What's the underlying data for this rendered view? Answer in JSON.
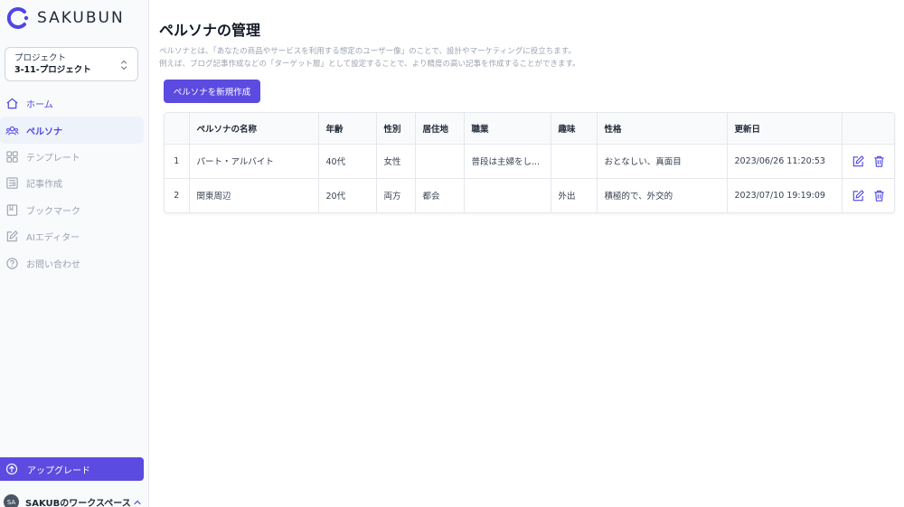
{
  "brand": {
    "name": "SAKUBUN"
  },
  "project": {
    "label": "プロジェクト",
    "name": "3-11-プロジェクト"
  },
  "nav": {
    "items": [
      {
        "label": "ホーム",
        "icon": "home-icon"
      },
      {
        "label": "ペルソナ",
        "icon": "persona-icon"
      },
      {
        "label": "テンプレート",
        "icon": "template-icon"
      },
      {
        "label": "記事作成",
        "icon": "article-icon"
      },
      {
        "label": "ブックマーク",
        "icon": "bookmark-icon"
      },
      {
        "label": "AIエディター",
        "icon": "editor-icon"
      },
      {
        "label": "お問い合わせ",
        "icon": "help-icon"
      }
    ]
  },
  "upgrade": {
    "label": "アップグレード"
  },
  "workspace": {
    "initials": "SA",
    "name": "SAKUBのワークスペース"
  },
  "page": {
    "title": "ペルソナの管理",
    "desc1": "ペルソナとは、「あなたの商品やサービスを利用する想定のユーザー像」のことで、設計やマーケティングに役立ちます。",
    "desc2": "例えば、ブログ記事作成などの「ターゲット層」として設定することで、より精度の高い記事を作成することができます。",
    "new_button": "ペルソナを新規作成"
  },
  "table": {
    "headers": [
      "",
      "ペルソナの名称",
      "年齢",
      "性別",
      "居住地",
      "職業",
      "趣味",
      "性格",
      "更新日",
      ""
    ],
    "rows": [
      {
        "no": "1",
        "name": "パート・アルバイト",
        "age": "40代",
        "gender": "女性",
        "residence": "",
        "job": "普段は主婦をし...",
        "hobby": "",
        "personality": "おとなしい、真面目",
        "updated": "2023/06/26 11:20:53"
      },
      {
        "no": "2",
        "name": "関東周辺",
        "age": "20代",
        "gender": "両方",
        "residence": "都会",
        "job": "",
        "hobby": "外出",
        "personality": "積極的で、外交的",
        "updated": "2023/07/10 19:19:09"
      }
    ]
  },
  "colors": {
    "accent": "#5b4be0",
    "active_text": "#4f46e5",
    "muted": "#9ca3af"
  }
}
